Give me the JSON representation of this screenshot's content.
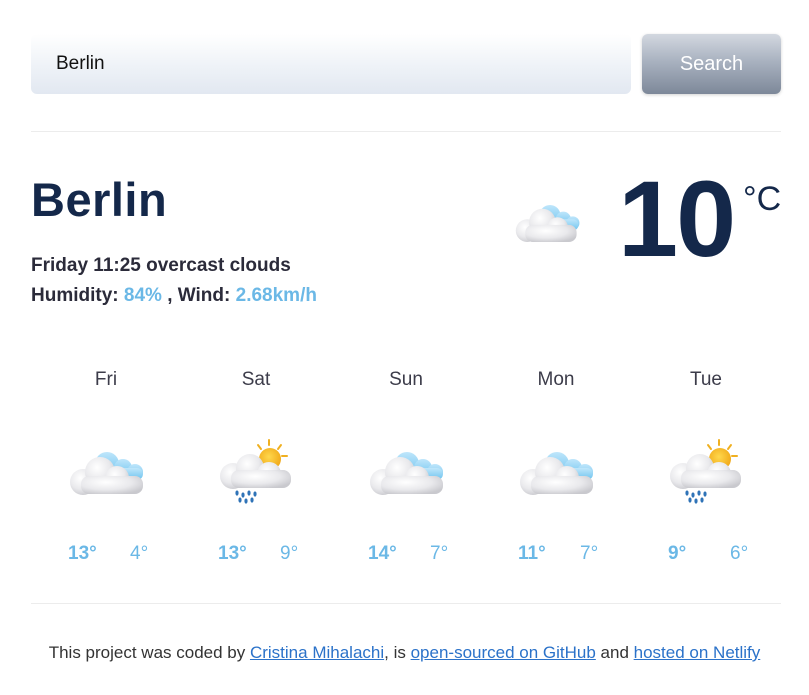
{
  "search": {
    "value": "Berlin",
    "button_label": "Search"
  },
  "current": {
    "city": "Berlin",
    "day_time": "Friday 11:25",
    "description": "overcast clouds",
    "humidity_label": "Humidity:",
    "humidity_value": "84%",
    "wind_label": ", Wind:",
    "wind_value": "2.68km/h",
    "temperature": "10",
    "unit": "°C",
    "icon": "overcast-clouds-icon"
  },
  "forecast": [
    {
      "day": "Fri",
      "max": "13°",
      "min": "4°",
      "icon": "overcast-clouds-icon"
    },
    {
      "day": "Sat",
      "max": "13°",
      "min": "9°",
      "icon": "sun-cloud-rain-icon"
    },
    {
      "day": "Sun",
      "max": "14°",
      "min": "7°",
      "icon": "overcast-clouds-icon"
    },
    {
      "day": "Mon",
      "max": "11°",
      "min": "7°",
      "icon": "overcast-clouds-icon"
    },
    {
      "day": "Tue",
      "max": "9°",
      "min": "6°",
      "icon": "sun-cloud-rain-icon"
    }
  ],
  "footer": {
    "text1": "This project was coded by ",
    "author_link": "Cristina Mihalachi",
    "text2": ", is ",
    "github_link": "open-sourced on GitHub",
    "text3": " and ",
    "netlify_link": "hosted on Netlify"
  },
  "colors": {
    "accent": "#6bb8e6",
    "heading": "#14284a",
    "link": "#2b72c9"
  }
}
